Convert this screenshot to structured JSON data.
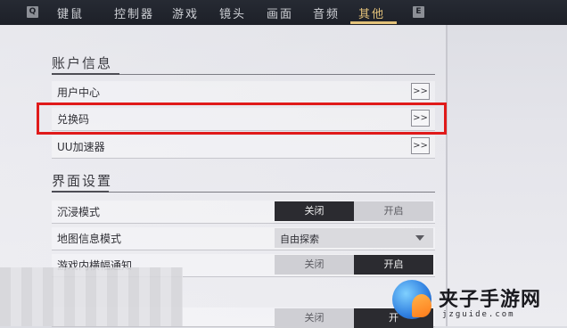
{
  "keyhints": {
    "left": "Q",
    "right": "E"
  },
  "tabs": [
    {
      "label": "键鼠"
    },
    {
      "label": "控制器"
    },
    {
      "label": "游戏"
    },
    {
      "label": "镜头"
    },
    {
      "label": "画面"
    },
    {
      "label": "音频"
    },
    {
      "label": "其他"
    }
  ],
  "active_tab_index": 6,
  "account_section": {
    "title": "账户信息",
    "rows": [
      {
        "label": "用户中心",
        "action": ">>"
      },
      {
        "label": "兑换码",
        "action": ">>"
      },
      {
        "label": "UU加速器",
        "action": ">>"
      }
    ]
  },
  "ui_section": {
    "title": "界面设置",
    "rows": [
      {
        "label": "沉浸模式",
        "options": [
          "关闭",
          "开启"
        ],
        "selected": "关闭"
      },
      {
        "label": "地图信息模式",
        "select_value": "自由探索"
      },
      {
        "label": "游戏内横幅通知",
        "options": [
          "关闭",
          "开启"
        ],
        "selected": "开启"
      },
      {
        "label": "",
        "options": [
          "关闭",
          "开"
        ],
        "selected": "开"
      }
    ]
  },
  "highlight_color": "#e01a1a",
  "accent_color": "#e3c27a",
  "watermark": {
    "title": "夹子手游网",
    "url": "jzguide.com"
  }
}
